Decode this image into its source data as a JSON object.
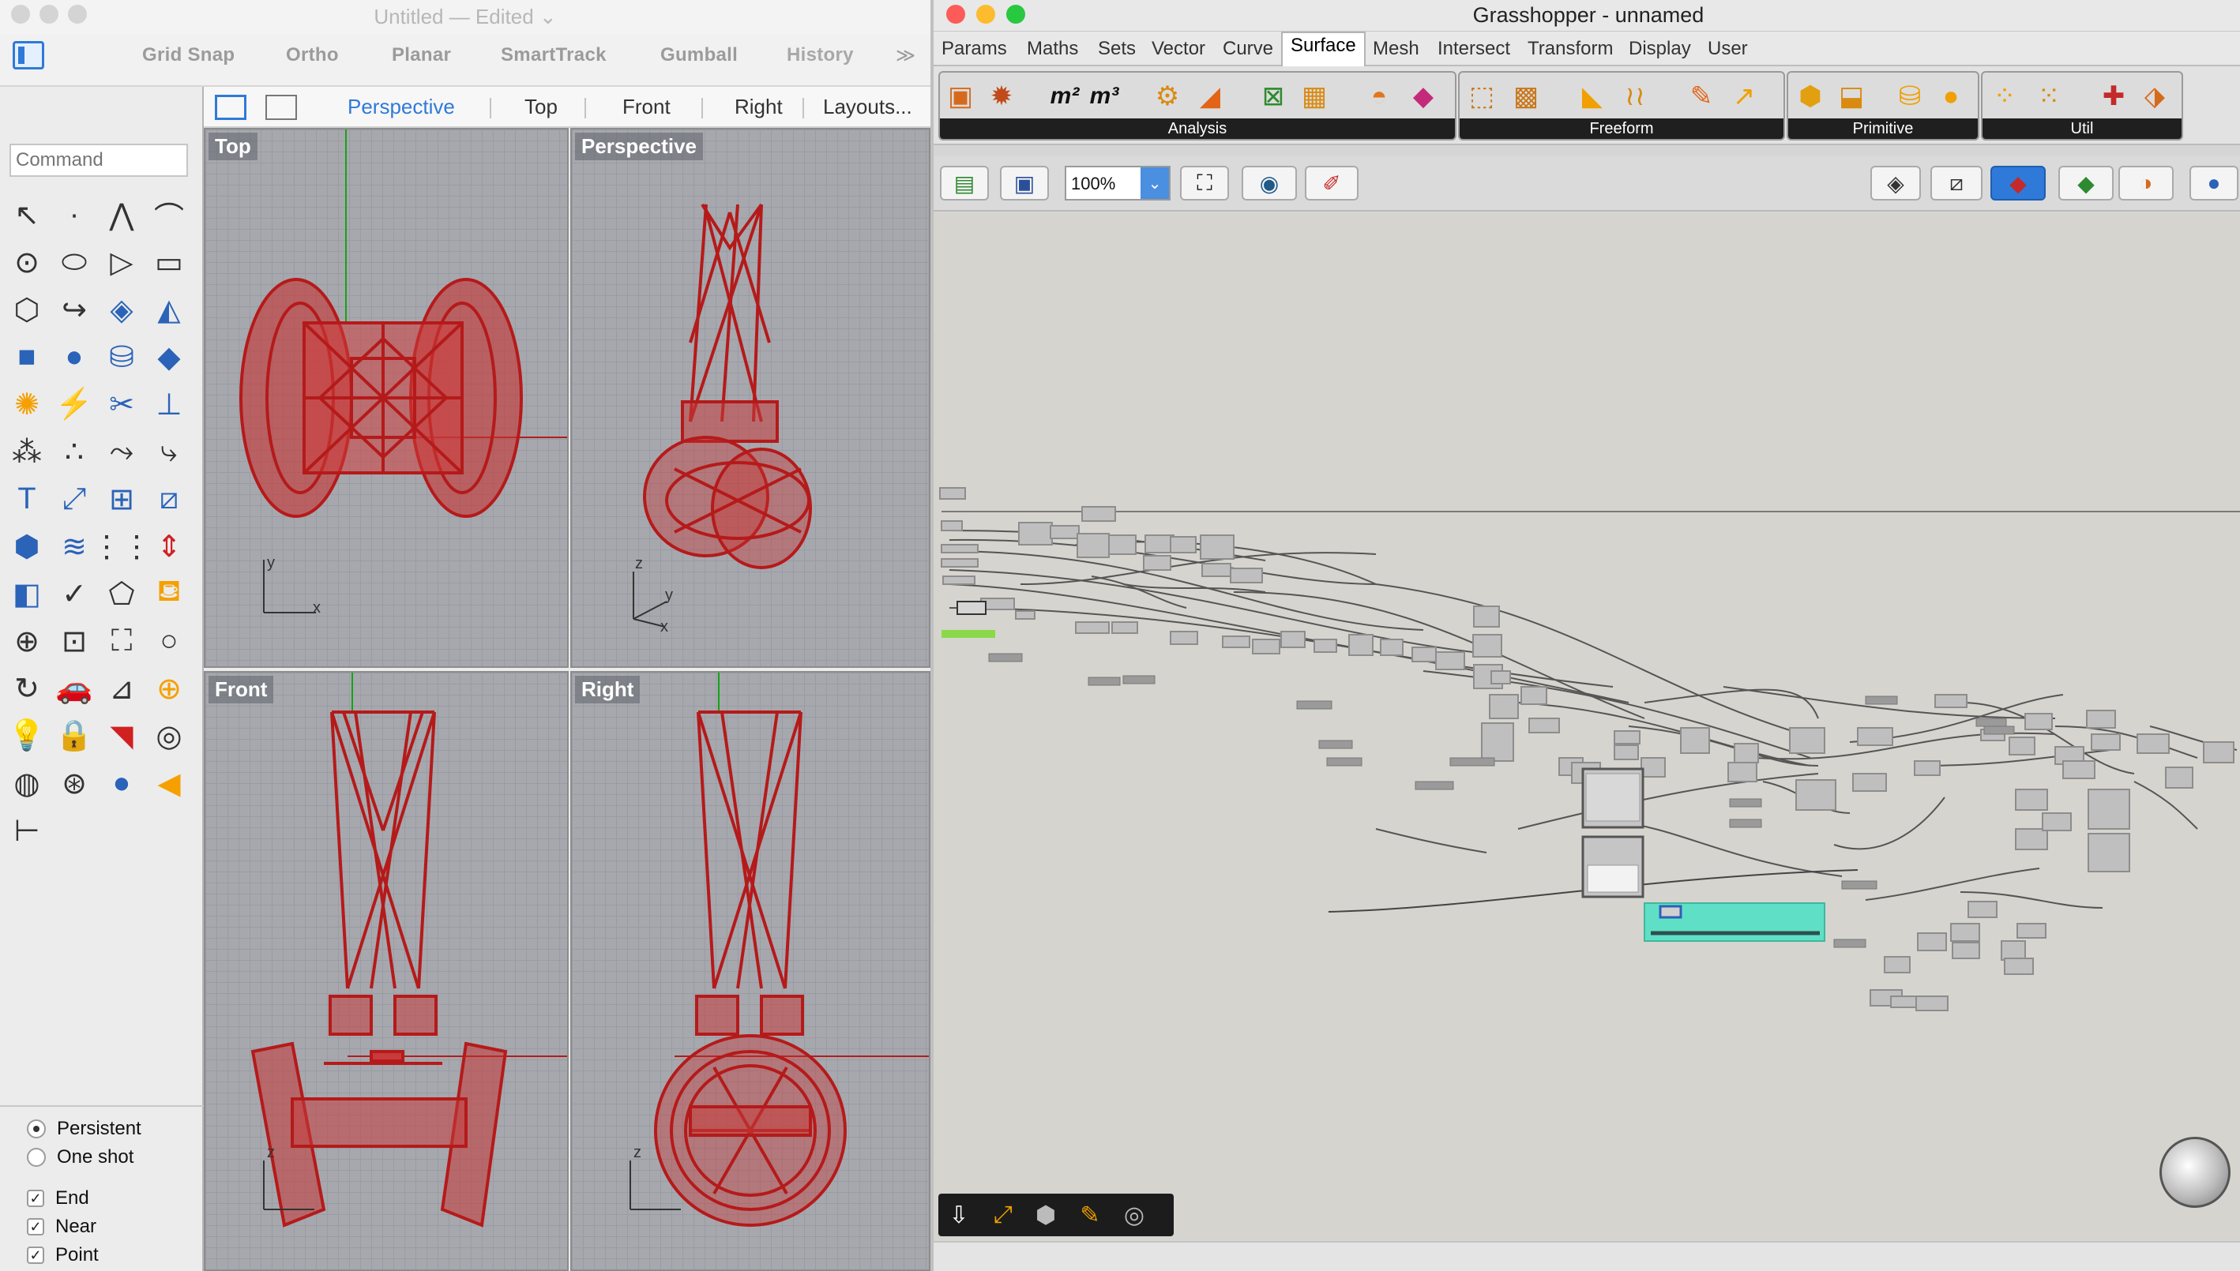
{
  "rhino": {
    "title": "Untitled — Edited ⌄",
    "toolbar": {
      "grid_snap": "Grid Snap",
      "ortho": "Ortho",
      "planar": "Planar",
      "smarttrack": "SmartTrack",
      "gumball": "Gumball",
      "history": "History",
      "more": "≫"
    },
    "view_tabs": [
      "Perspective",
      "Top",
      "Front",
      "Right",
      "Layouts..."
    ],
    "active_view_tab": "Perspective",
    "command_placeholder": "Command",
    "viewports": {
      "top": "Top",
      "perspective": "Perspective",
      "front": "Front",
      "right": "Right"
    },
    "osnap": {
      "persistent": "Persistent",
      "one_shot": "One shot",
      "end": "End",
      "near": "Near",
      "point": "Point"
    },
    "colors": {
      "model_red": "#c21f1f",
      "accent_blue": "#2f7ad8"
    }
  },
  "grasshopper": {
    "title": "Grasshopper - unnamed",
    "menu": [
      "Params",
      "Maths",
      "Sets",
      "Vector",
      "Curve",
      "Surface",
      "Mesh",
      "Intersect",
      "Transform",
      "Display",
      "User"
    ],
    "active_menu": "Surface",
    "ribbon_groups": [
      "Analysis",
      "Freeform",
      "Primitive",
      "Util"
    ],
    "zoom": "100%",
    "accent_teal": "#5fe0c6"
  }
}
